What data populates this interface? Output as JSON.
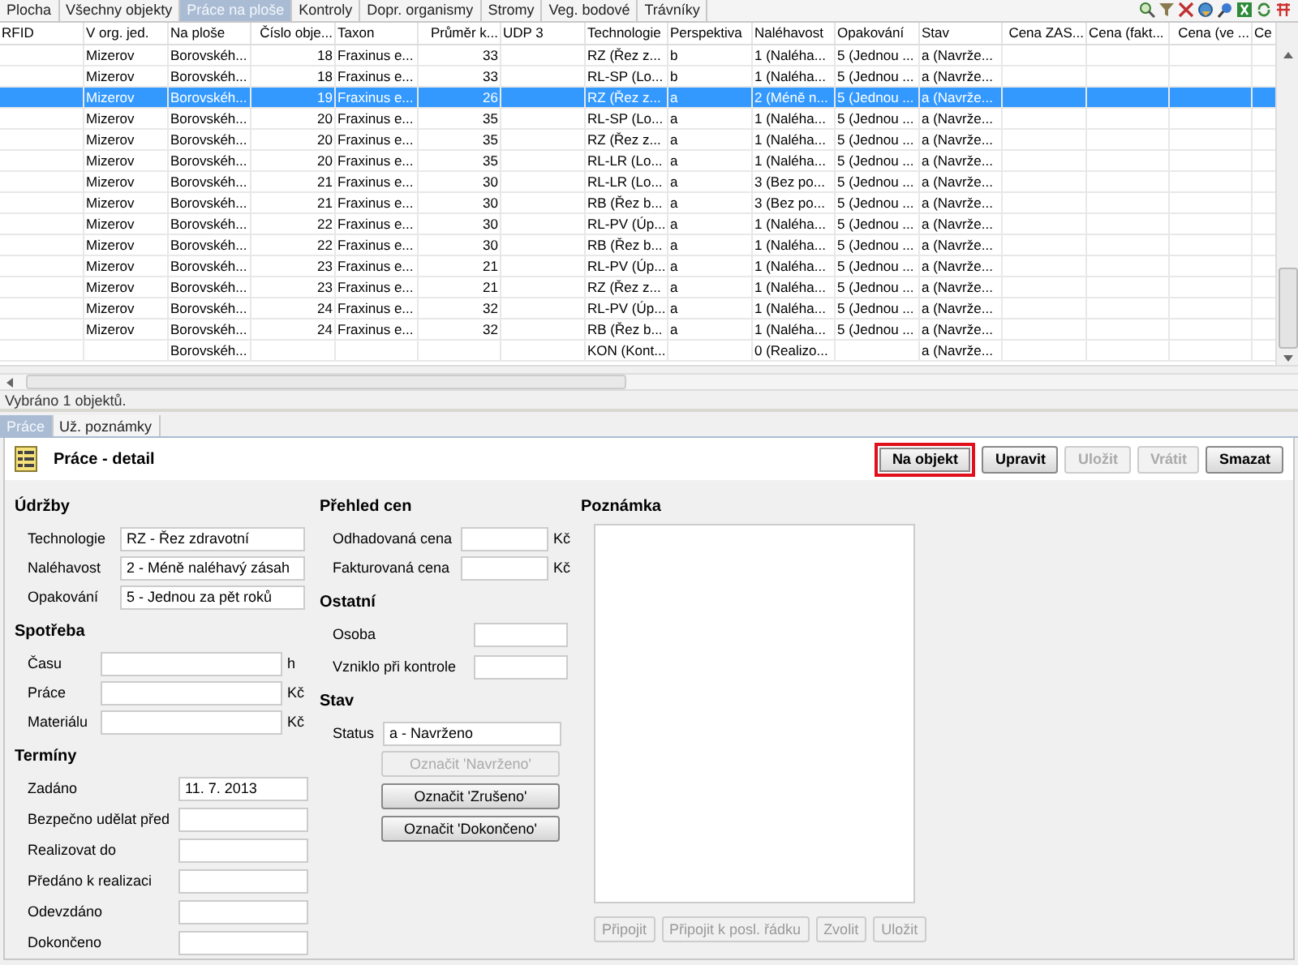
{
  "top_tabs": [
    {
      "label": "Plocha",
      "selected": false
    },
    {
      "label": "Všechny objekty",
      "selected": false
    },
    {
      "label": "Práce na ploše",
      "selected": true
    },
    {
      "label": "Kontroly",
      "selected": false
    },
    {
      "label": "Dopr. organismy",
      "selected": false
    },
    {
      "label": "Stromy",
      "selected": false
    },
    {
      "label": "Veg. bodové",
      "selected": false
    },
    {
      "label": "Trávníky",
      "selected": false
    }
  ],
  "table": {
    "columns": [
      {
        "label": "RFID",
        "kind": "text"
      },
      {
        "label": "V org. jed.",
        "kind": "text"
      },
      {
        "label": "Na ploše",
        "kind": "text"
      },
      {
        "label": "Číslo obje...",
        "kind": "number"
      },
      {
        "label": "Taxon",
        "kind": "text"
      },
      {
        "label": "Průměr k...",
        "kind": "number"
      },
      {
        "label": "UDP 3",
        "kind": "text"
      },
      {
        "label": "Technologie",
        "kind": "text"
      },
      {
        "label": "Perspektiva",
        "kind": "text"
      },
      {
        "label": "Naléhavost",
        "kind": "text"
      },
      {
        "label": "Opakování",
        "kind": "text"
      },
      {
        "label": "Stav",
        "kind": "text"
      },
      {
        "label": "Cena ZAS...",
        "kind": "number"
      },
      {
        "label": "Cena (fakt...",
        "kind": "text"
      },
      {
        "label": "Cena (ve ...",
        "kind": "number"
      },
      {
        "label": "Ce",
        "kind": "text"
      }
    ],
    "rows": [
      {
        "selected": false,
        "cells": [
          "",
          "Mizerov",
          "Borovskéh...",
          "18",
          "Fraxinus e...",
          "33",
          "",
          "RZ (Řez z...",
          "b",
          "1 (Naléha...",
          "5 (Jednou ...",
          "a (Navrže...",
          "",
          "",
          "",
          ""
        ]
      },
      {
        "selected": false,
        "cells": [
          "",
          "Mizerov",
          "Borovskéh...",
          "18",
          "Fraxinus e...",
          "33",
          "",
          "RL-SP (Lo...",
          "b",
          "1 (Naléha...",
          "5 (Jednou ...",
          "a (Navrže...",
          "",
          "",
          "",
          ""
        ]
      },
      {
        "selected": true,
        "cells": [
          "",
          "Mizerov",
          "Borovskéh...",
          "19",
          "Fraxinus e...",
          "26",
          "",
          "RZ (Řez z...",
          "a",
          "2 (Méně n...",
          "5 (Jednou ...",
          "a (Navrže...",
          "",
          "",
          "",
          ""
        ]
      },
      {
        "selected": false,
        "cells": [
          "",
          "Mizerov",
          "Borovskéh...",
          "20",
          "Fraxinus e...",
          "35",
          "",
          "RL-SP (Lo...",
          "a",
          "1 (Naléha...",
          "5 (Jednou ...",
          "a (Navrže...",
          "",
          "",
          "",
          ""
        ]
      },
      {
        "selected": false,
        "cells": [
          "",
          "Mizerov",
          "Borovskéh...",
          "20",
          "Fraxinus e...",
          "35",
          "",
          "RZ (Řez z...",
          "a",
          "1 (Naléha...",
          "5 (Jednou ...",
          "a (Navrže...",
          "",
          "",
          "",
          ""
        ]
      },
      {
        "selected": false,
        "cells": [
          "",
          "Mizerov",
          "Borovskéh...",
          "20",
          "Fraxinus e...",
          "35",
          "",
          "RL-LR (Lo...",
          "a",
          "1 (Naléha...",
          "5 (Jednou ...",
          "a (Navrže...",
          "",
          "",
          "",
          ""
        ]
      },
      {
        "selected": false,
        "cells": [
          "",
          "Mizerov",
          "Borovskéh...",
          "21",
          "Fraxinus e...",
          "30",
          "",
          "RL-LR (Lo...",
          "a",
          "3 (Bez po...",
          "5 (Jednou ...",
          "a (Navrže...",
          "",
          "",
          "",
          ""
        ]
      },
      {
        "selected": false,
        "cells": [
          "",
          "Mizerov",
          "Borovskéh...",
          "21",
          "Fraxinus e...",
          "30",
          "",
          "RB (Řez b...",
          "a",
          "3 (Bez po...",
          "5 (Jednou ...",
          "a (Navrže...",
          "",
          "",
          "",
          ""
        ]
      },
      {
        "selected": false,
        "cells": [
          "",
          "Mizerov",
          "Borovskéh...",
          "22",
          "Fraxinus e...",
          "30",
          "",
          "RL-PV (Úp...",
          "a",
          "1 (Naléha...",
          "5 (Jednou ...",
          "a (Navrže...",
          "",
          "",
          "",
          ""
        ]
      },
      {
        "selected": false,
        "cells": [
          "",
          "Mizerov",
          "Borovskéh...",
          "22",
          "Fraxinus e...",
          "30",
          "",
          "RB (Řez b...",
          "a",
          "1 (Naléha...",
          "5 (Jednou ...",
          "a (Navrže...",
          "",
          "",
          "",
          ""
        ]
      },
      {
        "selected": false,
        "cells": [
          "",
          "Mizerov",
          "Borovskéh...",
          "23",
          "Fraxinus e...",
          "21",
          "",
          "RL-PV (Úp...",
          "a",
          "1 (Naléha...",
          "5 (Jednou ...",
          "a (Navrže...",
          "",
          "",
          "",
          ""
        ]
      },
      {
        "selected": false,
        "cells": [
          "",
          "Mizerov",
          "Borovskéh...",
          "23",
          "Fraxinus e...",
          "21",
          "",
          "RZ (Řez z...",
          "a",
          "1 (Naléha...",
          "5 (Jednou ...",
          "a (Navrže...",
          "",
          "",
          "",
          ""
        ]
      },
      {
        "selected": false,
        "cells": [
          "",
          "Mizerov",
          "Borovskéh...",
          "24",
          "Fraxinus e...",
          "32",
          "",
          "RL-PV (Úp...",
          "a",
          "1 (Naléha...",
          "5 (Jednou ...",
          "a (Navrže...",
          "",
          "",
          "",
          ""
        ]
      },
      {
        "selected": false,
        "cells": [
          "",
          "Mizerov",
          "Borovskéh...",
          "24",
          "Fraxinus e...",
          "32",
          "",
          "RB (Řez b...",
          "a",
          "1 (Naléha...",
          "5 (Jednou ...",
          "a (Navrže...",
          "",
          "",
          "",
          ""
        ]
      },
      {
        "selected": false,
        "cells": [
          "",
          "",
          "Borovskéh...",
          "",
          "",
          "",
          "",
          "KON (Kont...",
          "",
          "0 (Realizo...",
          "",
          "a (Navrže...",
          "",
          "",
          "",
          ""
        ]
      }
    ]
  },
  "status_bar": "Vybráno 1 objektů.",
  "bottom_tabs": [
    {
      "label": "Práce",
      "selected": true
    },
    {
      "label": "Už. poznámky",
      "selected": false
    }
  ],
  "detail": {
    "title": "Práce - detail",
    "buttons": [
      {
        "label": "Na objekt",
        "disabled": false,
        "highlighted": true
      },
      {
        "label": "Upravit",
        "disabled": false,
        "highlighted": false
      },
      {
        "label": "Uložit",
        "disabled": true,
        "highlighted": false
      },
      {
        "label": "Vrátit",
        "disabled": true,
        "highlighted": false
      },
      {
        "label": "Smazat",
        "disabled": false,
        "highlighted": false
      }
    ],
    "udrzby": {
      "heading": "Údržby",
      "fields": [
        {
          "label": "Technologie",
          "value": "RZ - Řez zdravotní"
        },
        {
          "label": "Naléhavost",
          "value": "2 - Méně naléhavý zásah"
        },
        {
          "label": "Opakování",
          "value": "5 - Jednou za pět roků"
        }
      ]
    },
    "spotreba": {
      "heading": "Spotřeba",
      "fields": [
        {
          "label": "Času",
          "unit": "h"
        },
        {
          "label": "Práce",
          "unit": "Kč"
        },
        {
          "label": "Materiálu",
          "unit": "Kč"
        }
      ]
    },
    "terminy": {
      "heading": "Termíny",
      "fields": [
        {
          "label": "Zadáno",
          "value": "11. 7. 2013"
        },
        {
          "label": "Bezpečno udělat před"
        },
        {
          "label": "Realizovat do"
        },
        {
          "label": "Předáno k realizaci"
        },
        {
          "label": "Odevzdáno"
        },
        {
          "label": "Dokončeno"
        }
      ]
    },
    "prehled_cen": {
      "heading": "Přehled cen",
      "fields": [
        {
          "label": "Odhadovaná cena",
          "unit": "Kč"
        },
        {
          "label": "Fakturovaná cena",
          "unit": "Kč"
        }
      ]
    },
    "ostatni": {
      "heading": "Ostatní",
      "fields": [
        {
          "label": "Osoba"
        },
        {
          "label": "Vzniklo při kontrole"
        }
      ]
    },
    "stav": {
      "heading": "Stav",
      "status_label": "Status",
      "status_value": "a - Navrženo",
      "buttons": [
        {
          "label": "Označit 'Navrženo'",
          "disabled": true
        },
        {
          "label": "Označit 'Zrušeno'",
          "disabled": false
        },
        {
          "label": "Označit 'Dokončeno'",
          "disabled": false
        }
      ]
    },
    "poznamka": {
      "heading": "Poznámka",
      "buttons": [
        {
          "label": "Připojit",
          "disabled": true
        },
        {
          "label": "Připojit k posl. řádku",
          "disabled": true
        },
        {
          "label": "Zvolit",
          "disabled": true
        },
        {
          "label": "Uložit",
          "disabled": true
        }
      ]
    }
  }
}
